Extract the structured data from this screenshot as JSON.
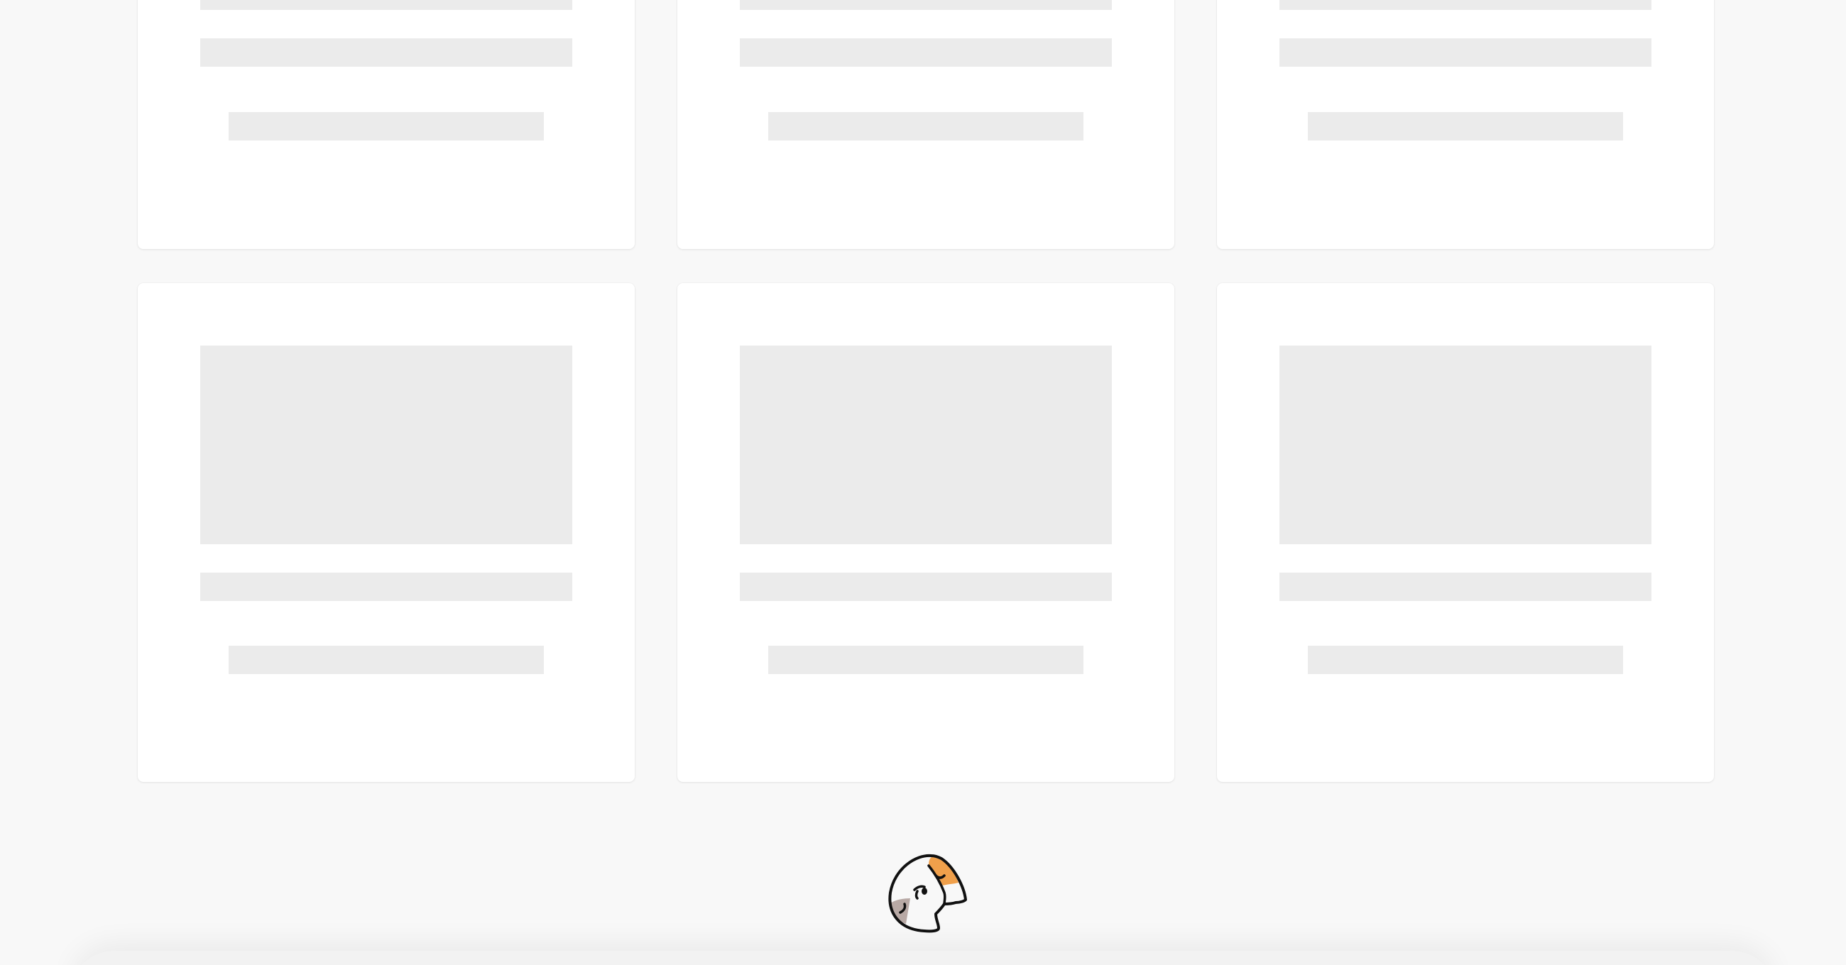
{
  "page": {
    "state": "loading",
    "background_color": "#f8f8f8"
  },
  "cards": [
    {
      "id": "card-1",
      "state": "loading"
    },
    {
      "id": "card-2",
      "state": "loading"
    },
    {
      "id": "card-3",
      "state": "loading"
    },
    {
      "id": "card-4",
      "state": "loading"
    },
    {
      "id": "card-5",
      "state": "loading"
    },
    {
      "id": "card-6",
      "state": "loading"
    }
  ],
  "skeleton_color": "#ebebeb",
  "card_color": "#ffffff",
  "mascot": {
    "icon": "parrot-logo-icon",
    "colors": {
      "orange": "#f0a04b",
      "grey": "#b8a9a5",
      "outline": "#111111"
    }
  }
}
